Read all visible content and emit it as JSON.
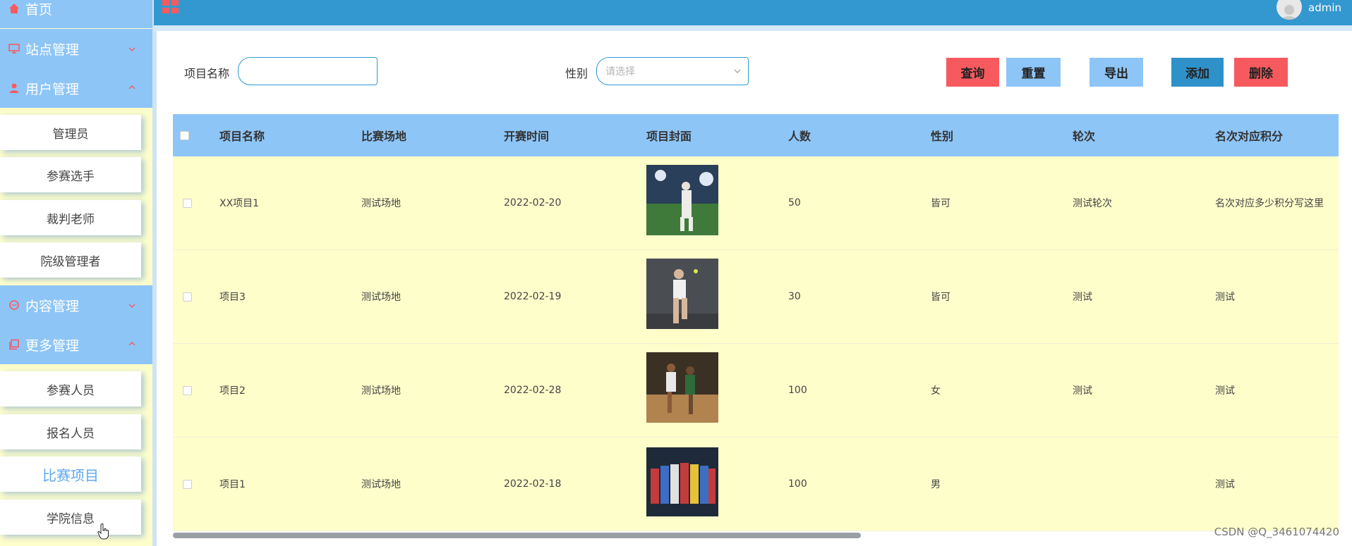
{
  "sidebar": {
    "home": "首页",
    "sites": "站点管理",
    "users": "用户管理",
    "user_items": [
      "管理员",
      "参赛选手",
      "裁判老师",
      "院级管理者"
    ],
    "content": "内容管理",
    "more": "更多管理",
    "more_items": [
      "参赛人员",
      "报名人员",
      "比赛项目",
      "学院信息"
    ],
    "active_item": "比赛项目"
  },
  "topbar": {
    "username": "admin"
  },
  "search": {
    "project_name_label": "项目名称",
    "project_name_value": "",
    "gender_label": "性别",
    "gender_placeholder": "请选择"
  },
  "buttons": {
    "query": "查询",
    "reset": "重置",
    "export": "导出",
    "add": "添加",
    "delete": "删除"
  },
  "table": {
    "columns": [
      "项目名称",
      "比赛场地",
      "开赛时间",
      "项目封面",
      "人数",
      "性别",
      "轮次",
      "名次对应积分"
    ],
    "rows": [
      {
        "name": "XX项目1",
        "venue": "测试场地",
        "date": "2022-02-20",
        "count": "50",
        "gender": "皆可",
        "round": "测试轮次",
        "points": "名次对应多少积分写这里"
      },
      {
        "name": "项目3",
        "venue": "测试场地",
        "date": "2022-02-19",
        "count": "30",
        "gender": "皆可",
        "round": "测试",
        "points": "测试"
      },
      {
        "name": "项目2",
        "venue": "测试场地",
        "date": "2022-02-28",
        "count": "100",
        "gender": "女",
        "round": "测试",
        "points": "测试"
      },
      {
        "name": "项目1",
        "venue": "测试场地",
        "date": "2022-02-18",
        "count": "100",
        "gender": "男",
        "round": "",
        "points": "测试"
      }
    ]
  },
  "watermark": "CSDN @Q_3461074420",
  "colors": {
    "sidebar_header": "#8ec5f7",
    "sidebar_bg": "#fefecb",
    "topbar": "#3398cf",
    "danger": "#f65a5f",
    "primary": "#2f91c9",
    "light_primary": "#8ec5f7"
  }
}
